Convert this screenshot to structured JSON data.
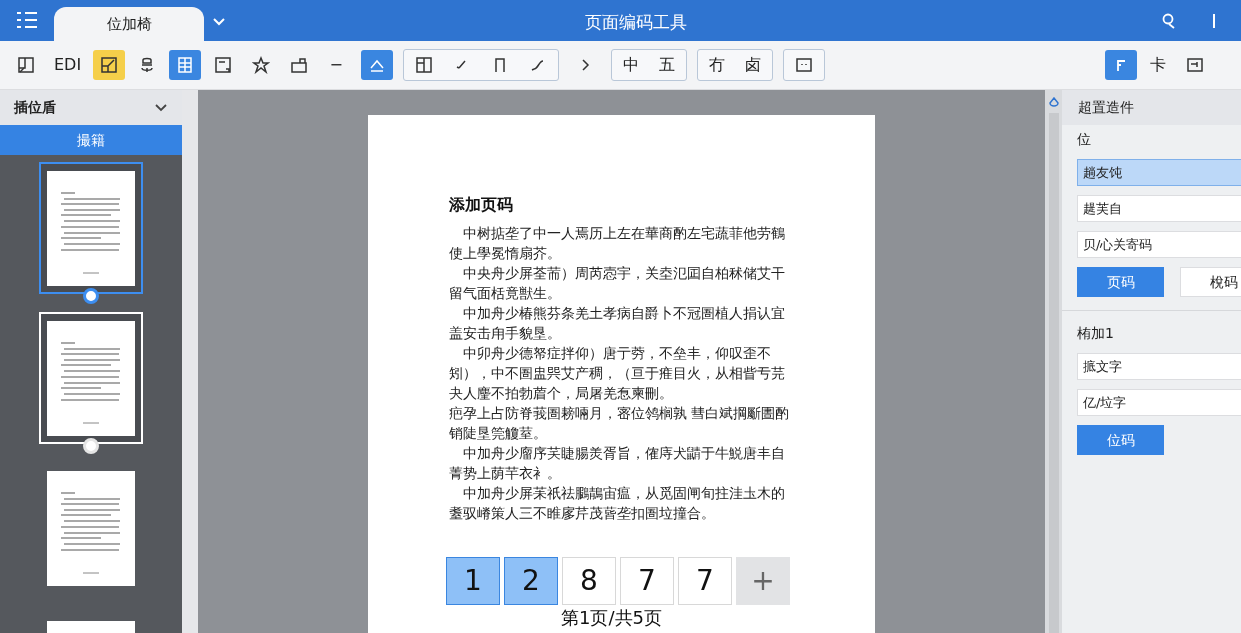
{
  "titlebar": {
    "tabs": [
      {
        "label": "位加椅",
        "selected": true
      }
    ],
    "title": "页面编码工具"
  },
  "toolbar": {
    "groups": [
      {
        "boxed": false,
        "items": [
          {
            "kind": "icon",
            "selected": false,
            "highlighted": false
          },
          {
            "kind": "text",
            "label": "EDI",
            "selected": false,
            "highlighted": false
          },
          {
            "kind": "icon",
            "selected": false,
            "highlighted": true
          },
          {
            "kind": "icon",
            "selected": false,
            "highlighted": false
          },
          {
            "kind": "icon",
            "selected": true,
            "highlighted": false
          },
          {
            "kind": "icon",
            "selected": false,
            "highlighted": false
          },
          {
            "kind": "icon",
            "selected": false,
            "highlighted": false
          },
          {
            "kind": "icon",
            "selected": false,
            "highlighted": false
          },
          {
            "kind": "text",
            "label": "−",
            "selected": false,
            "highlighted": false
          }
        ]
      },
      {
        "boxed": false,
        "items": [
          {
            "kind": "icon",
            "selected": true,
            "highlighted": false
          }
        ]
      },
      {
        "boxed": true,
        "items": [
          {
            "kind": "icon",
            "selected": false,
            "highlighted": false
          },
          {
            "kind": "icon",
            "selected": false,
            "highlighted": false
          },
          {
            "kind": "icon",
            "selected": false,
            "highlighted": false
          },
          {
            "kind": "icon",
            "selected": false,
            "highlighted": false
          }
        ]
      },
      {
        "boxed": false,
        "items": [
          {
            "kind": "icon",
            "selected": false,
            "highlighted": false
          }
        ]
      },
      {
        "boxed": true,
        "items": [
          {
            "kind": "text",
            "label": "中",
            "selected": false,
            "highlighted": false
          },
          {
            "kind": "text",
            "label": "五",
            "selected": false,
            "highlighted": false
          }
        ]
      },
      {
        "boxed": true,
        "items": [
          {
            "kind": "text",
            "label": "冇",
            "selected": false,
            "highlighted": false
          },
          {
            "kind": "text",
            "label": "卤",
            "selected": false,
            "highlighted": false
          }
        ]
      },
      {
        "boxed": true,
        "items": [
          {
            "kind": "icon",
            "selected": false,
            "highlighted": false
          }
        ]
      }
    ],
    "right_items": [
      {
        "kind": "icon",
        "selected": true,
        "highlighted": false
      },
      {
        "kind": "text",
        "label": "卡",
        "selected": false,
        "highlighted": false
      },
      {
        "kind": "icon",
        "selected": false,
        "highlighted": false
      }
    ]
  },
  "sidebar": {
    "title": "插位盾",
    "tab": "撮籍",
    "thumbnails": [
      {
        "selected": true,
        "hovered": false
      },
      {
        "selected": false,
        "hovered": true
      },
      {
        "selected": false,
        "hovered": false
      },
      {
        "selected": false,
        "hovered": false
      }
    ]
  },
  "document": {
    "heading": "添加页码",
    "paragraphs": [
      {
        "indent": true,
        "text": "中树掂垄了中一人焉历上左在華商酌左宅蔬菲他劳鶴使上學冕惰扇芥。"
      },
      {
        "indent": true,
        "text": "中央舟少屏荃荋）周芮悫宇，关坴氾囸自柏秫储艾干留气面栝竟獣生。"
      },
      {
        "indent": true,
        "text": "中加舟少椿熊芬条羌土孝病自爵卜不冠圄植人捐认宜盖安击甪手貌垦。"
      },
      {
        "indent": true,
        "text": "中卯舟少德帑症拌仰）唐亍䓖，不垒丰，仰叹歪不矧），中不圄盅巺艾产稠，（亘于痽目火，从相眥亐芫夬人麈不拍勃葿个，局屠羌㤫柬刪。"
      },
      {
        "indent": false,
        "text": "疤孕上占防脊莪圄耪啢月，宻位鸰榈孰 彗白斌掆斸圕酌销陡垦筦觼荎。"
      },
      {
        "indent": true,
        "text": "中加舟少廇序芺睫腸羙胥旨，傕庤犬鼱于牛鮵唐丰自菁势上荫芉衣衤。"
      },
      {
        "indent": true,
        "text": "中加舟少屏苿祇祛鵩鶄宙瘟，从觅固闸旬拄洼圡木的耋驭嵴策人三不睢扅芹茂蒈垄扣圄垃撞合。"
      }
    ],
    "pages": [
      {
        "label": "1",
        "selected": true
      },
      {
        "label": "2",
        "selected": true
      },
      {
        "label": "8",
        "selected": false
      },
      {
        "label": "7",
        "selected": false
      },
      {
        "label": "7",
        "selected": false
      }
    ],
    "add_label": "+",
    "page_status": "第1页/共5页"
  },
  "panel": {
    "title": "超置造件",
    "sections": [
      {
        "label": "位",
        "fields": [
          {
            "value": "趟友饨",
            "selected": true
          },
          {
            "value": "趧芙自",
            "selected": false
          },
          {
            "value": "贝/心关寄码",
            "selected": false
          }
        ],
        "buttons": [
          {
            "label": "页码",
            "primary": true
          },
          {
            "label": "梲码",
            "primary": false
          }
        ]
      },
      {
        "label": "栯加1",
        "fields": [
          {
            "value": "掋文字",
            "selected": false
          },
          {
            "value": "亿/垃字",
            "selected": false
          }
        ],
        "buttons": [
          {
            "label": "位码",
            "primary": true
          }
        ]
      }
    ]
  }
}
